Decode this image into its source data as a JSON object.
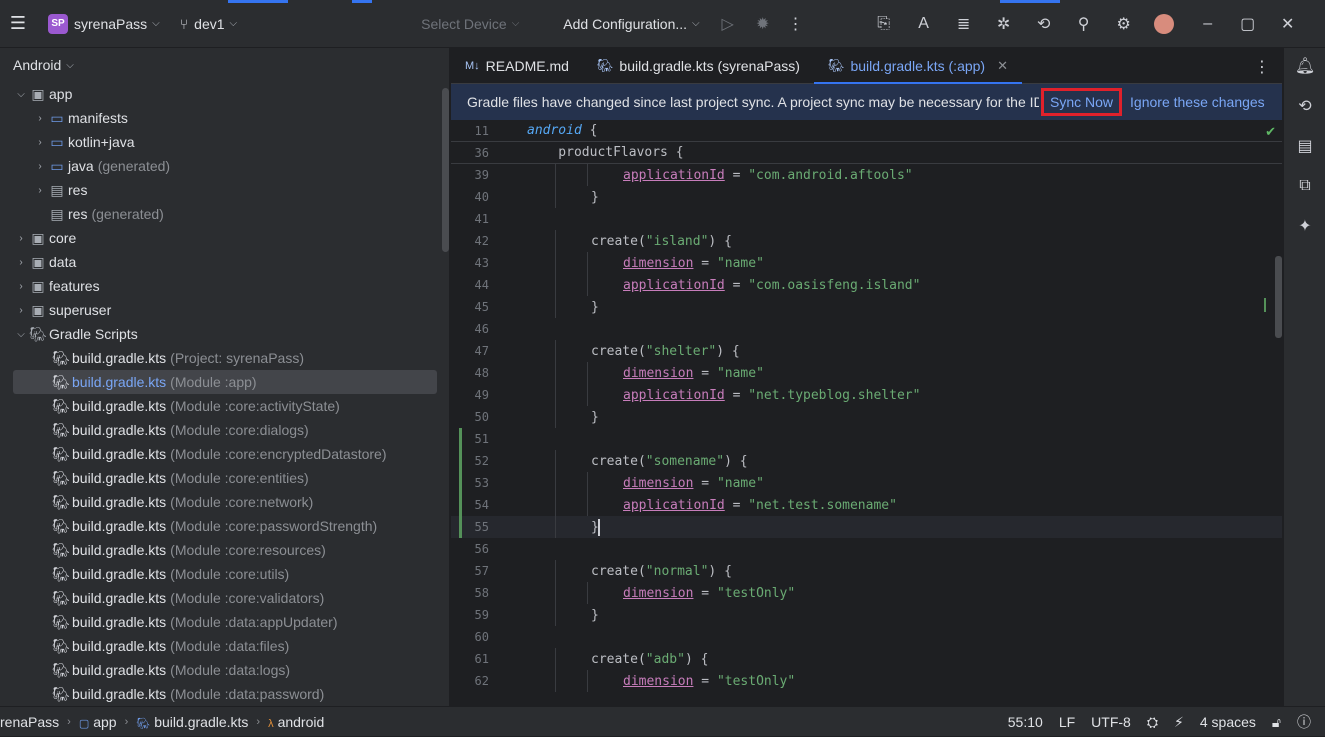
{
  "topbar": {
    "project_badge": "SP",
    "project_name": "syrenaPass",
    "branch": "dev1",
    "device_placeholder": "Select Device",
    "run_config": "Add Configuration...",
    "icons": [
      "menu-icon",
      "branch-icon",
      "run-icon",
      "debug-icon",
      "more-icon",
      "build-icon",
      "translate-icon",
      "structure-icon",
      "bug-icon",
      "gradle-sync-icon",
      "search-icon",
      "settings-icon",
      "avatar",
      "minimize-icon",
      "maximize-icon",
      "close-icon"
    ]
  },
  "project_panel": {
    "title": "Android",
    "items": [
      {
        "label": "app",
        "suffix": "",
        "level": 1,
        "expanded": true,
        "type": "module"
      },
      {
        "label": "manifests",
        "suffix": "",
        "level": 2,
        "expanded": false,
        "type": "folder"
      },
      {
        "label": "kotlin+java",
        "suffix": "",
        "level": 2,
        "expanded": false,
        "type": "folder"
      },
      {
        "label": "java",
        "suffix": "(generated)",
        "level": 2,
        "expanded": false,
        "type": "folder-gen"
      },
      {
        "label": "res",
        "suffix": "",
        "level": 2,
        "expanded": false,
        "type": "res"
      },
      {
        "label": "res",
        "suffix": "(generated)",
        "level": 2,
        "expanded": null,
        "type": "res"
      },
      {
        "label": "core",
        "suffix": "",
        "level": 1,
        "expanded": false,
        "type": "module"
      },
      {
        "label": "data",
        "suffix": "",
        "level": 1,
        "expanded": false,
        "type": "module"
      },
      {
        "label": "features",
        "suffix": "",
        "level": 1,
        "expanded": false,
        "type": "module"
      },
      {
        "label": "superuser",
        "suffix": "",
        "level": 1,
        "expanded": false,
        "type": "module"
      },
      {
        "label": "Gradle Scripts",
        "suffix": "",
        "level": 1,
        "expanded": true,
        "type": "gradle"
      },
      {
        "label": "build.gradle.kts",
        "suffix": "(Project: syrenaPass)",
        "level": 2,
        "type": "gradle-file"
      },
      {
        "label": "build.gradle.kts",
        "suffix": "(Module :app)",
        "level": 2,
        "type": "gradle-file",
        "selected": true
      },
      {
        "label": "build.gradle.kts",
        "suffix": "(Module :core:activityState)",
        "level": 2,
        "type": "gradle-file"
      },
      {
        "label": "build.gradle.kts",
        "suffix": "(Module :core:dialogs)",
        "level": 2,
        "type": "gradle-file"
      },
      {
        "label": "build.gradle.kts",
        "suffix": "(Module :core:encryptedDatastore)",
        "level": 2,
        "type": "gradle-file"
      },
      {
        "label": "build.gradle.kts",
        "suffix": "(Module :core:entities)",
        "level": 2,
        "type": "gradle-file"
      },
      {
        "label": "build.gradle.kts",
        "suffix": "(Module :core:network)",
        "level": 2,
        "type": "gradle-file"
      },
      {
        "label": "build.gradle.kts",
        "suffix": "(Module :core:passwordStrength)",
        "level": 2,
        "type": "gradle-file"
      },
      {
        "label": "build.gradle.kts",
        "suffix": "(Module :core:resources)",
        "level": 2,
        "type": "gradle-file"
      },
      {
        "label": "build.gradle.kts",
        "suffix": "(Module :core:utils)",
        "level": 2,
        "type": "gradle-file"
      },
      {
        "label": "build.gradle.kts",
        "suffix": "(Module :core:validators)",
        "level": 2,
        "type": "gradle-file"
      },
      {
        "label": "build.gradle.kts",
        "suffix": "(Module :data:appUpdater)",
        "level": 2,
        "type": "gradle-file"
      },
      {
        "label": "build.gradle.kts",
        "suffix": "(Module :data:files)",
        "level": 2,
        "type": "gradle-file"
      },
      {
        "label": "build.gradle.kts",
        "suffix": "(Module :data:logs)",
        "level": 2,
        "type": "gradle-file"
      },
      {
        "label": "build.gradle.kts",
        "suffix": "(Module :data:password)",
        "level": 2,
        "type": "gradle-file"
      }
    ]
  },
  "tabs": [
    {
      "label": "README.md",
      "icon": "markdown-icon",
      "active": false
    },
    {
      "label": "build.gradle.kts (syrenaPass)",
      "icon": "gradle-file-icon",
      "active": false
    },
    {
      "label": "build.gradle.kts (:app)",
      "icon": "gradle-file-icon",
      "active": true
    }
  ],
  "banner": {
    "message": "Gradle files have changed since last project sync. A project sync may be necessary for the IDE to work properly.",
    "sync_now": "Sync Now",
    "ignore": "Ignore these changes"
  },
  "code": {
    "sticky": [
      {
        "n": "11",
        "text": "android {"
      },
      {
        "n": "36",
        "text": "    productFlavors {"
      }
    ],
    "lines": [
      {
        "n": "39",
        "indent": 3,
        "parts": [
          [
            "prop",
            "applicationId"
          ],
          [
            "p",
            " = "
          ],
          [
            "str",
            "\"com.android.aftools\""
          ]
        ]
      },
      {
        "n": "40",
        "indent": 2,
        "parts": [
          [
            "p",
            "}"
          ]
        ]
      },
      {
        "n": "41",
        "indent": 0,
        "parts": []
      },
      {
        "n": "42",
        "indent": 2,
        "parts": [
          [
            "p",
            "create("
          ],
          [
            "str",
            "\"island\""
          ],
          [
            "p",
            ") {"
          ]
        ]
      },
      {
        "n": "43",
        "indent": 3,
        "parts": [
          [
            "prop",
            "dimension"
          ],
          [
            "p",
            " = "
          ],
          [
            "str",
            "\"name\""
          ]
        ]
      },
      {
        "n": "44",
        "indent": 3,
        "parts": [
          [
            "prop",
            "applicationId"
          ],
          [
            "p",
            " = "
          ],
          [
            "str",
            "\"com.oasisfeng.island\""
          ]
        ]
      },
      {
        "n": "45",
        "indent": 2,
        "parts": [
          [
            "p",
            "}"
          ]
        ]
      },
      {
        "n": "46",
        "indent": 0,
        "parts": []
      },
      {
        "n": "47",
        "indent": 2,
        "parts": [
          [
            "p",
            "create("
          ],
          [
            "str",
            "\"shelter\""
          ],
          [
            "p",
            ") {"
          ]
        ]
      },
      {
        "n": "48",
        "indent": 3,
        "parts": [
          [
            "prop",
            "dimension"
          ],
          [
            "p",
            " = "
          ],
          [
            "str",
            "\"name\""
          ]
        ]
      },
      {
        "n": "49",
        "indent": 3,
        "parts": [
          [
            "prop",
            "applicationId"
          ],
          [
            "p",
            " = "
          ],
          [
            "str",
            "\"net.typeblog.shelter\""
          ]
        ]
      },
      {
        "n": "50",
        "indent": 2,
        "parts": [
          [
            "p",
            "}"
          ]
        ]
      },
      {
        "n": "51",
        "indent": 0,
        "parts": [],
        "changed": true
      },
      {
        "n": "52",
        "indent": 2,
        "parts": [
          [
            "p",
            "create("
          ],
          [
            "str",
            "\"somename\""
          ],
          [
            "p",
            ") {"
          ]
        ],
        "changed": true
      },
      {
        "n": "53",
        "indent": 3,
        "parts": [
          [
            "prop",
            "dimension"
          ],
          [
            "p",
            " = "
          ],
          [
            "str",
            "\"name\""
          ]
        ],
        "changed": true
      },
      {
        "n": "54",
        "indent": 3,
        "parts": [
          [
            "prop",
            "applicationId"
          ],
          [
            "p",
            " = "
          ],
          [
            "str",
            "\"net.test.somename\""
          ]
        ],
        "changed": true
      },
      {
        "n": "55",
        "indent": 2,
        "parts": [
          [
            "p",
            "}"
          ]
        ],
        "changed": true,
        "current": true
      },
      {
        "n": "56",
        "indent": 0,
        "parts": []
      },
      {
        "n": "57",
        "indent": 2,
        "parts": [
          [
            "p",
            "create("
          ],
          [
            "str",
            "\"normal\""
          ],
          [
            "p",
            ") {"
          ]
        ]
      },
      {
        "n": "58",
        "indent": 3,
        "parts": [
          [
            "prop",
            "dimension"
          ],
          [
            "p",
            " = "
          ],
          [
            "str",
            "\"testOnly\""
          ]
        ]
      },
      {
        "n": "59",
        "indent": 2,
        "parts": [
          [
            "p",
            "}"
          ]
        ]
      },
      {
        "n": "60",
        "indent": 0,
        "parts": []
      },
      {
        "n": "61",
        "indent": 2,
        "parts": [
          [
            "p",
            "create("
          ],
          [
            "str",
            "\"adb\""
          ],
          [
            "p",
            ") {"
          ]
        ]
      },
      {
        "n": "62",
        "indent": 3,
        "parts": [
          [
            "prop",
            "dimension"
          ],
          [
            "p",
            " = "
          ],
          [
            "str",
            "\"testOnly\""
          ]
        ]
      }
    ]
  },
  "statusbar": {
    "breadcrumbs": [
      "renaPass",
      "app",
      "build.gradle.kts",
      "android"
    ],
    "position": "55:10",
    "line_ending": "LF",
    "encoding": "UTF-8",
    "indent": "4 spaces"
  },
  "colors": {
    "accent": "#3574f0",
    "highlight_box": "#e0212b",
    "banner_bg": "#25324d",
    "string": "#6aab73",
    "property": "#c77dbb",
    "keyword": "#56a8f5"
  }
}
